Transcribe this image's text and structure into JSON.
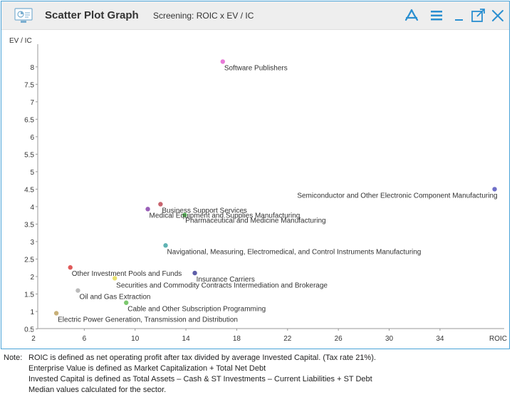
{
  "window": {
    "title": "Scatter Plot Graph",
    "subtitle": "Screening: ROIC x EV / IC"
  },
  "toolbar": {
    "icons": [
      "pdf-icon",
      "menu-icon",
      "minimize-icon",
      "popout-icon",
      "close-icon"
    ]
  },
  "colors": {
    "accent": "#2a8fd0",
    "border": "#4aa3d8"
  },
  "chart_data": {
    "type": "scatter",
    "title": "",
    "xlabel": "ROIC",
    "ylabel": "EV / IC",
    "xlim": [
      2,
      40
    ],
    "ylim": [
      0.5,
      8.2
    ],
    "xticks": [
      2,
      6,
      10,
      14,
      18,
      22,
      26,
      30,
      34
    ],
    "yticks": [
      0.5,
      1,
      1.5,
      2,
      2.5,
      3,
      3.5,
      4,
      4.5,
      5,
      5.5,
      6,
      6.5,
      7,
      7.5,
      8
    ],
    "grid": false,
    "points": [
      {
        "label": "Software Publishers",
        "x": 16.9,
        "y": 8.15,
        "color": "#e87ad8"
      },
      {
        "label": "Semiconductor and Other Electronic Component Manufacturing",
        "x": 38.3,
        "y": 4.5,
        "color": "#6f6fc8"
      },
      {
        "label": "Business Support Services",
        "x": 12.0,
        "y": 4.07,
        "color": "#c8646e"
      },
      {
        "label": "Medical Equipment and Supplies Manufacturing",
        "x": 11.0,
        "y": 3.93,
        "color": "#9a5fb8"
      },
      {
        "label": "Pharmaceutical and Medicine Manufacturing",
        "x": 13.9,
        "y": 3.76,
        "color": "#66cc66"
      },
      {
        "label": "Navigational, Measuring, Electromedical, and Control Instruments Manufacturing",
        "x": 12.4,
        "y": 2.89,
        "color": "#5fb3b3"
      },
      {
        "label": "Other Investment Pools and Funds",
        "x": 4.9,
        "y": 2.26,
        "color": "#e05a5a"
      },
      {
        "label": "Insurance Carriers",
        "x": 14.7,
        "y": 2.1,
        "color": "#5e5ea8"
      },
      {
        "label": "Securities and Commodity Contracts Intermediation and Brokerage",
        "x": 8.4,
        "y": 1.95,
        "color": "#e8e070"
      },
      {
        "label": "Oil and Gas Extraction",
        "x": 5.5,
        "y": 1.6,
        "color": "#bbbbbb"
      },
      {
        "label": "Cable and Other Subscription Programming",
        "x": 9.3,
        "y": 1.25,
        "color": "#7cc86e"
      },
      {
        "label": "Electric Power Generation, Transmission and Distribution",
        "x": 3.8,
        "y": 0.95,
        "color": "#c8b078"
      }
    ]
  },
  "notes": {
    "label": "Note:",
    "lines": [
      "ROIC is defined as net operating profit after tax divided by average Invested Capital. (Tax rate 21%).",
      "Enterprise Value is defined as Market Capitalization + Total Net Debt",
      "Invested Capital is defined as Total Assets – Cash & ST Investments – Current Liabilities + ST Debt",
      "Median values calculated for the sector."
    ]
  }
}
